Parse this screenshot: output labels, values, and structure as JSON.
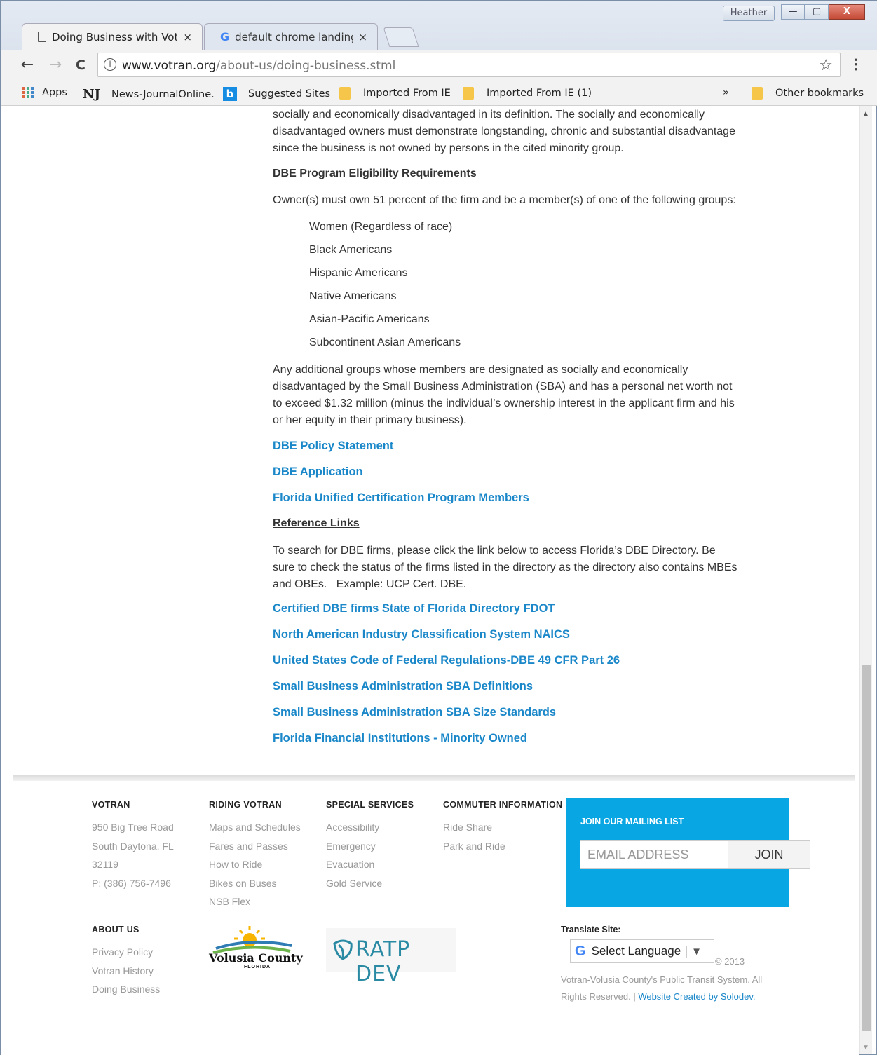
{
  "window": {
    "profile_name": "Heather",
    "controls": {
      "minimize": "—",
      "maximize": "▢",
      "close": "X"
    }
  },
  "tabs": [
    {
      "title": "Doing Business with Votr",
      "close": "×",
      "icon": "doc-icon"
    },
    {
      "title": "default chrome landing p",
      "close": "×",
      "icon": "google-icon"
    }
  ],
  "toolbar": {
    "back": "←",
    "forward": "→",
    "reload": "C",
    "url_host": "www.votran.org",
    "url_path": "/about-us/doing-business.stml",
    "star": "☆",
    "menu": "⋮"
  },
  "bookmarks": {
    "apps": "Apps",
    "nj_logo": "NJ",
    "news": "News-JournalOnline.",
    "bing_logo": "b",
    "suggested": "Suggested Sites",
    "imported1": "Imported From IE",
    "imported2": "Imported From IE (1)",
    "overflow": "»",
    "other": "Other bookmarks"
  },
  "content": {
    "intro_lines": [
      "socially and economically disadvantaged in its definition. The socially and economically",
      "disadvantaged owners must demonstrate longstanding, chronic and substantial disadvantage",
      "since the business is not owned by persons in the cited minority group."
    ],
    "eligibility_heading": "DBE Program Eligibility Requirements",
    "eligibility_text": "Owner(s) must own 51 percent of the firm and be a member(s) of one of the following groups:",
    "groups": [
      "Women (Regardless of race)",
      "Black Americans",
      "Hispanic Americans",
      "Native Americans",
      "Asian-Pacific Americans",
      "Subcontinent Asian Americans"
    ],
    "additional_lines": [
      "Any additional groups whose members are designated as socially and economically",
      "disadvantaged by the Small Business Administration (SBA) and has a personal net worth not",
      "to exceed $1.32 million (minus the individual’s ownership interest in the applicant firm and his",
      "or her equity in their primary business)."
    ],
    "dbe_links": [
      "DBE Policy Statement",
      "DBE Application",
      "Florida Unified Certification Program Members"
    ],
    "reference_heading": "Reference Links",
    "reference_lines": [
      "To search for DBE firms, please click the link below to access Florida’s DBE Directory. Be",
      "sure to check the status of the firms listed in the directory as the directory also contains MBEs",
      "and OBEs.   Example: UCP Cert. DBE."
    ],
    "reference_links": [
      "Certified DBE firms State of Florida Directory FDOT",
      "North American Industry Classification System NAICS",
      "United States Code of Federal Regulations-DBE 49 CFR Part 26",
      "Small Business Administration SBA Definitions",
      "Small Business Administration SBA Size Standards",
      "Florida Financial Institutions - Minority Owned"
    ]
  },
  "footer": {
    "votran": {
      "heading": "VOTRAN",
      "items": [
        "950 Big Tree Road",
        "South Daytona, FL",
        "32119",
        "P: (386) 756-7496"
      ]
    },
    "riding": {
      "heading": "RIDING VOTRAN",
      "items": [
        "Maps and Schedules",
        "Fares and Passes",
        "How to Ride",
        "Bikes on Buses",
        "NSB Flex"
      ]
    },
    "special": {
      "heading": "SPECIAL SERVICES",
      "items": [
        "Accessibility",
        "Emergency",
        "Evacuation",
        "Gold Service"
      ]
    },
    "commuter": {
      "heading": "COMMUTER INFORMATION",
      "items": [
        "Ride Share",
        "Park and Ride"
      ]
    },
    "about": {
      "heading": "ABOUT US",
      "items": [
        "Privacy Policy",
        "Votran History",
        "Doing Business"
      ]
    },
    "mailing": {
      "title": "JOIN OUR MAILING LIST",
      "placeholder": "EMAIL ADDRESS",
      "join": "JOIN"
    },
    "volusia_logo": {
      "name": "Volusia County",
      "sub": "FLORIDA"
    },
    "ratp_logo": "RATP DEV",
    "translate": {
      "label": "Translate Site:",
      "select": "Select Language",
      "caret": "▼",
      "g": "G"
    },
    "copyright": "© 2013",
    "legal_text": "Votran-Volusia County's Public Transit System. All Rights Reserved. | ",
    "legal_link": "Website Created by Solodev."
  },
  "colors": {
    "link": "#1a87c9",
    "mailbox": "#09a6e4",
    "text": "#333333",
    "footer_text": "#999999"
  }
}
